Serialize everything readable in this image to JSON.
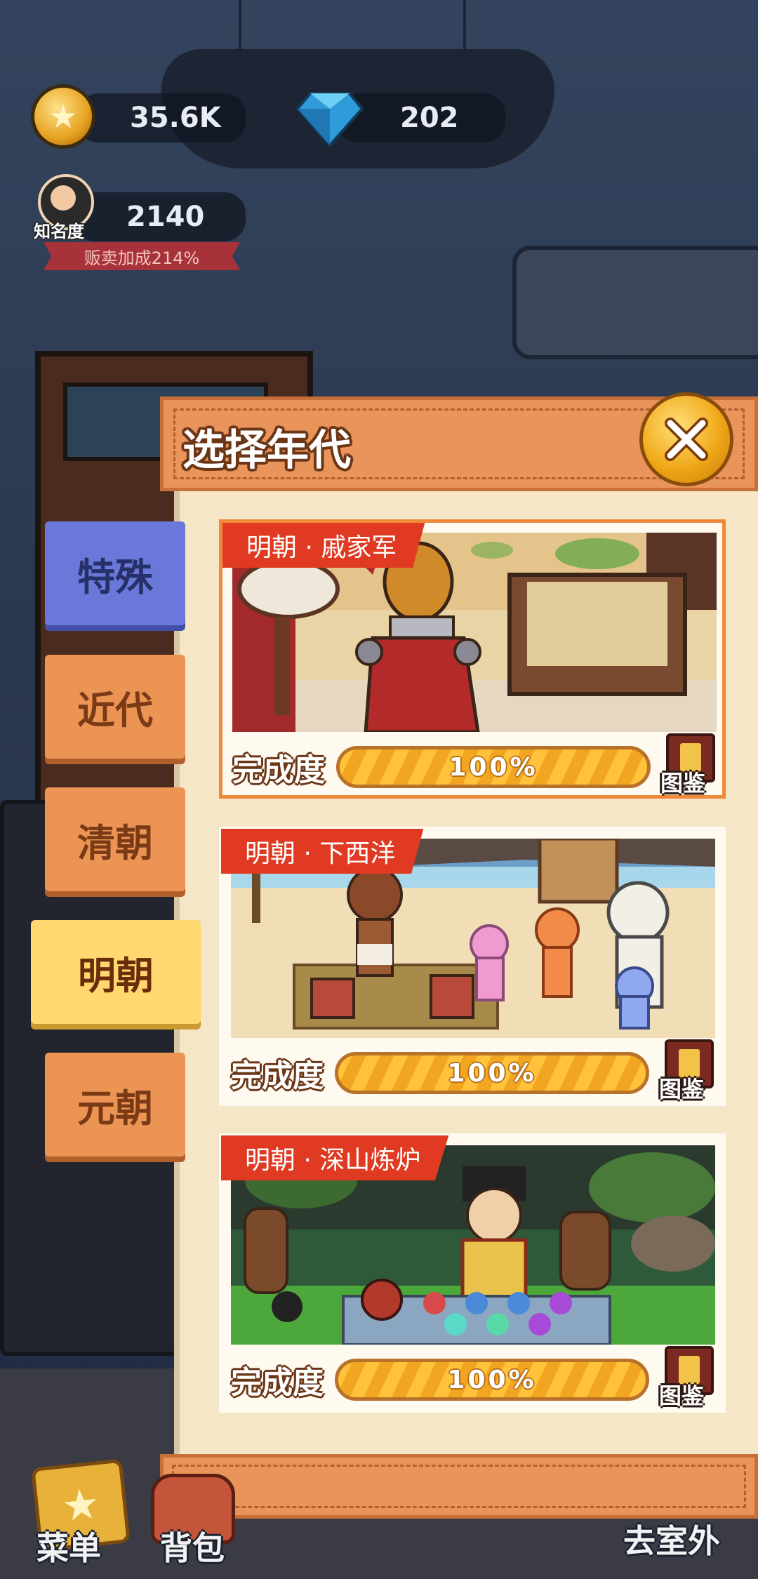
{
  "hud": {
    "coins": "35.6K",
    "gems": "202",
    "fame_value": "2140",
    "fame_label": "知名度",
    "sales_bonus": "贩卖加成214%"
  },
  "panel": {
    "title": "选择年代"
  },
  "tabs": [
    {
      "label": "特殊",
      "selected": false
    },
    {
      "label": "近代",
      "selected": false
    },
    {
      "label": "清朝",
      "selected": false
    },
    {
      "label": "明朝",
      "selected": true
    },
    {
      "label": "元朝",
      "selected": false
    }
  ],
  "levels": [
    {
      "tag": "明朝 · 戚家军",
      "progress_label": "完成度",
      "progress": "100%",
      "progress_fraction": 1.0,
      "album_label": "图鉴"
    },
    {
      "tag": "明朝 · 下西洋",
      "progress_label": "完成度",
      "progress": "100%",
      "progress_fraction": 1.0,
      "album_label": "图鉴"
    },
    {
      "tag": "明朝 · 深山炼炉",
      "progress_label": "完成度",
      "progress": "100%",
      "progress_fraction": 1.0,
      "album_label": "图鉴"
    }
  ],
  "nav": {
    "menu": "菜单",
    "bag": "背包",
    "outside": "去室外"
  },
  "colors": {
    "accent_orange": "#e9945a",
    "tag_red": "#e03a22",
    "tab_selected": "#ffd870",
    "tab_special": "#6a79d9"
  }
}
